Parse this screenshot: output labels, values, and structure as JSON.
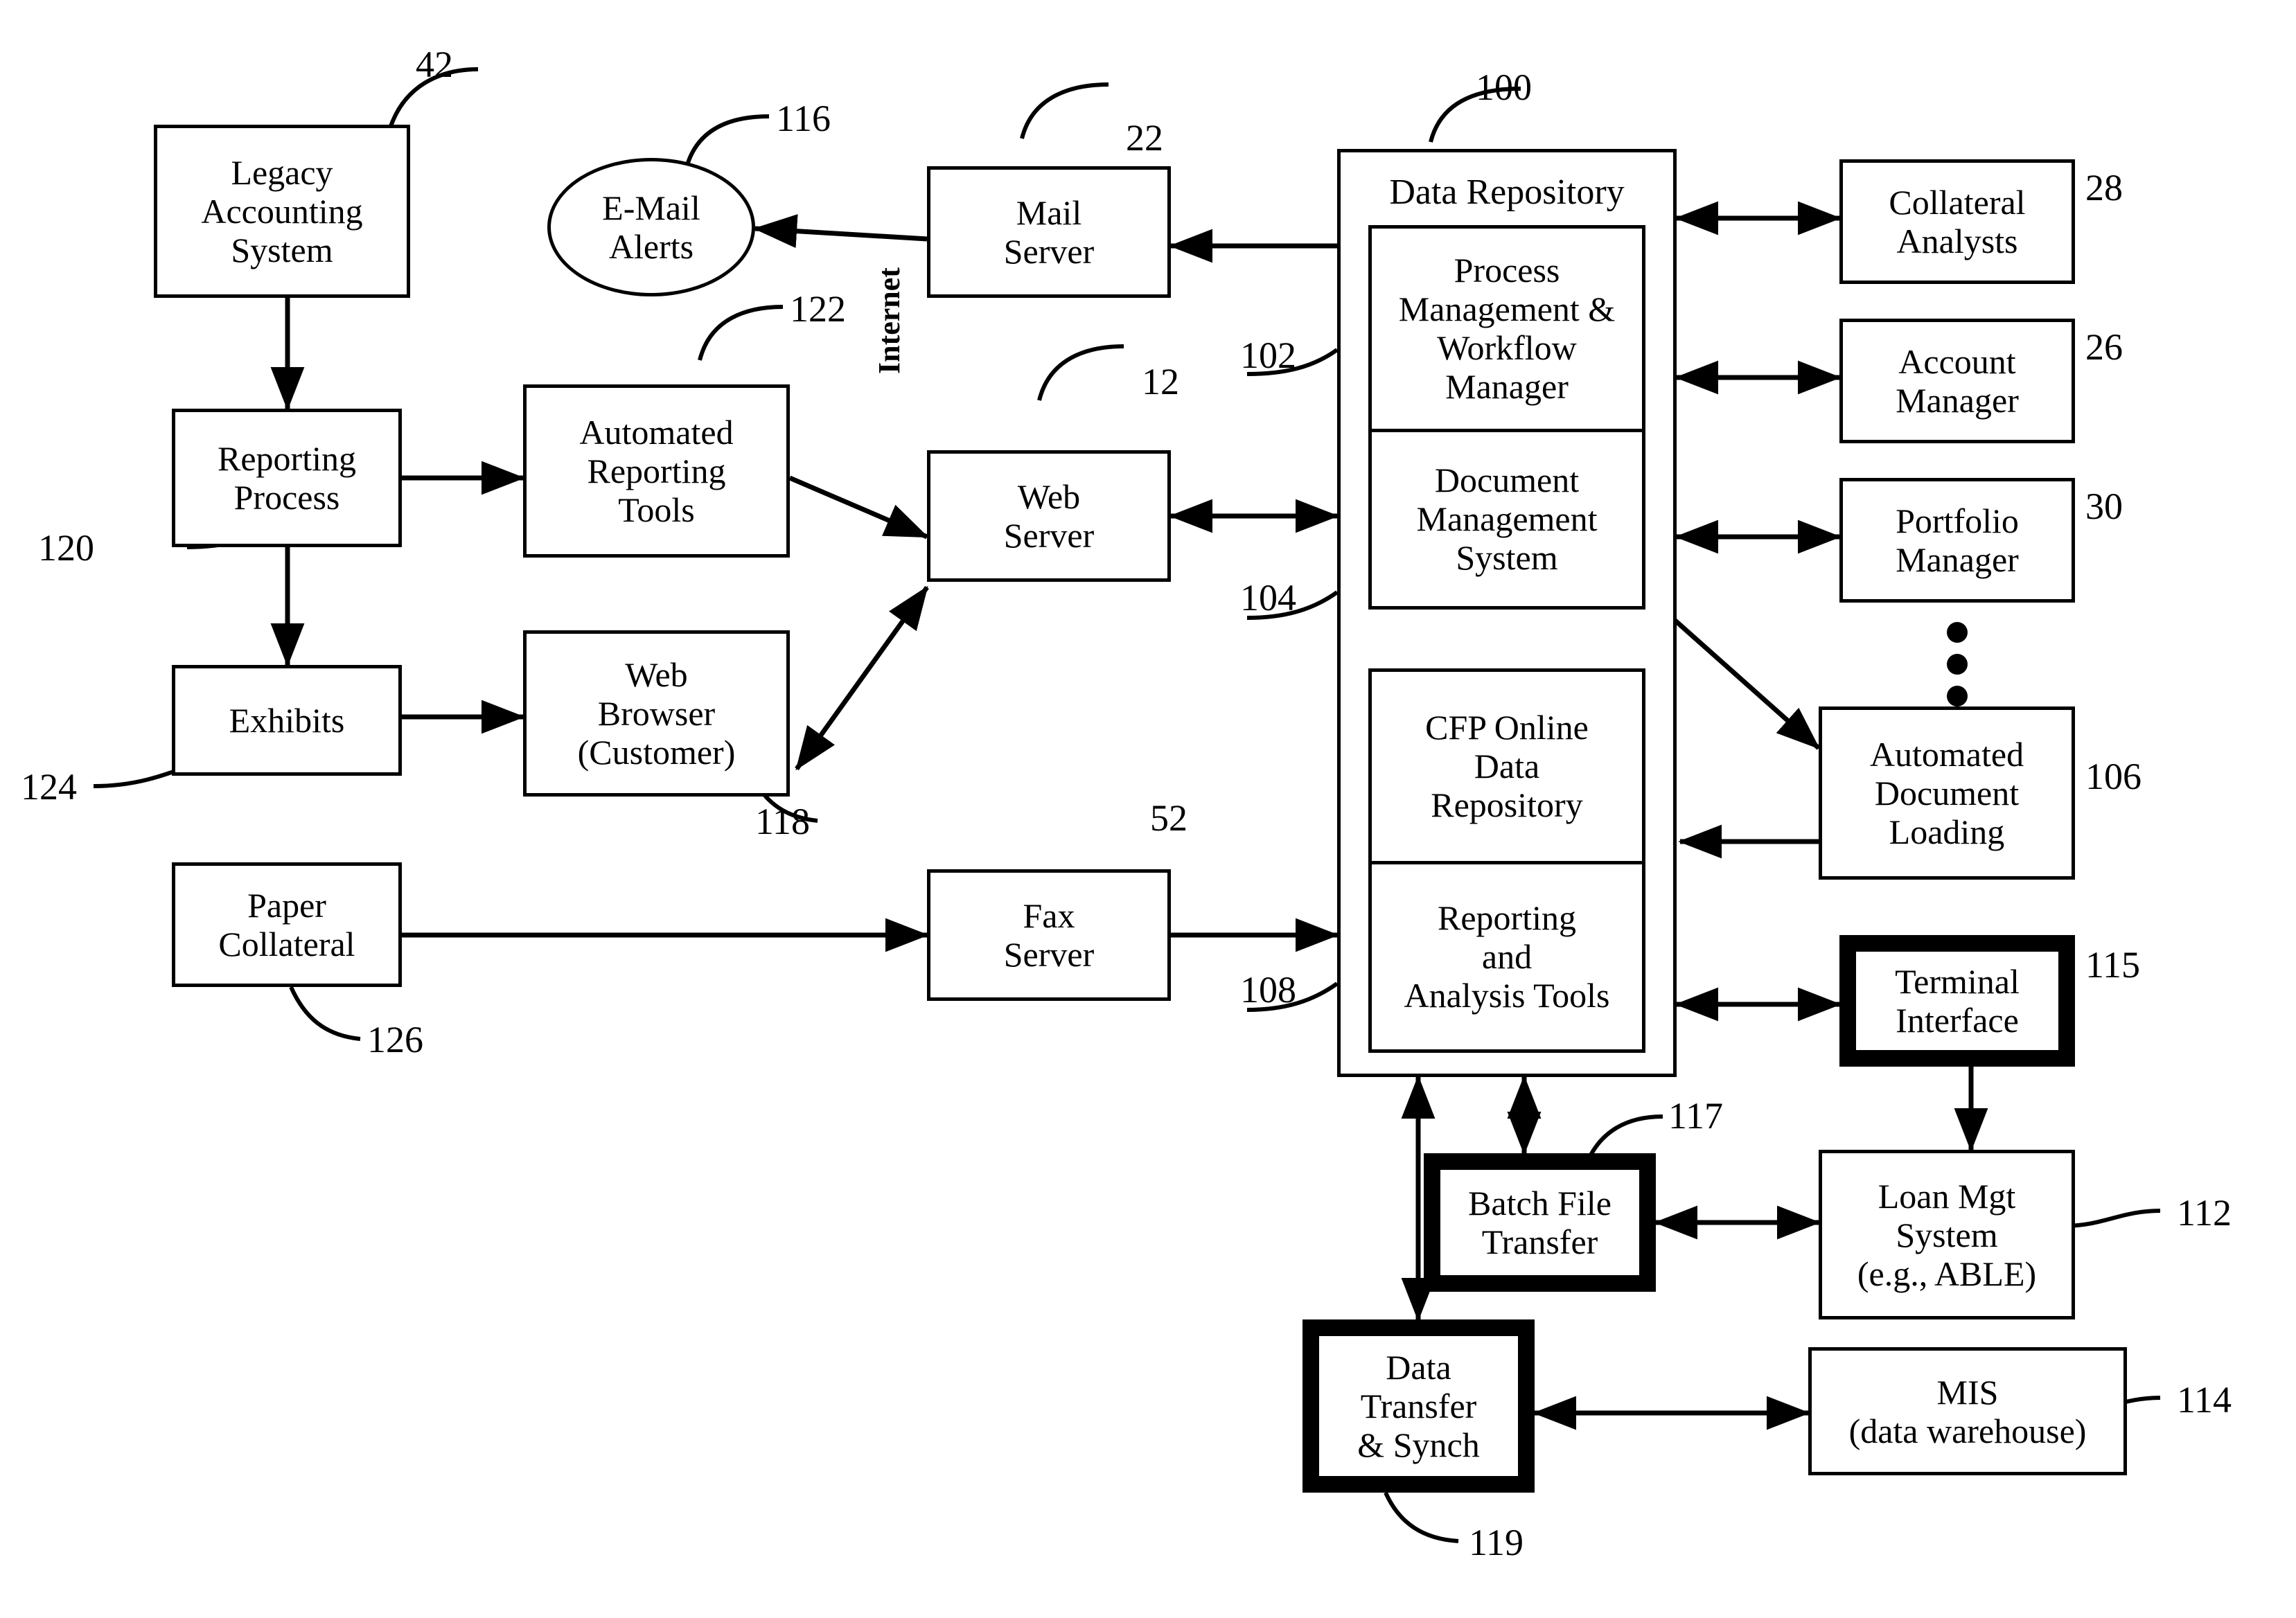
{
  "figure": {
    "type": "patent-system-block-diagram",
    "background": "#ffffff",
    "ink": "#000000"
  },
  "nodes": {
    "legacy_accounting_system": {
      "label": "Legacy\nAccounting\nSystem",
      "ref": "42"
    },
    "email_alerts": {
      "label": "E-Mail\nAlerts",
      "ref": "116",
      "shape": "ellipse"
    },
    "mail_server": {
      "label": "Mail\nServer",
      "ref": "22"
    },
    "reporting_process": {
      "label": "Reporting\nProcess",
      "ref": "120"
    },
    "automated_reporting_tools": {
      "label": "Automated\nReporting\nTools",
      "ref": "122"
    },
    "web_server": {
      "label": "Web\nServer",
      "ref": "12"
    },
    "exhibits": {
      "label": "Exhibits",
      "ref": "124"
    },
    "web_browser_customer": {
      "label": "Web\nBrowser\n(Customer)",
      "ref": "118"
    },
    "paper_collateral": {
      "label": "Paper\nCollateral",
      "ref": "126"
    },
    "fax_server": {
      "label": "Fax\nServer",
      "ref": "52"
    },
    "data_repository": {
      "label": "Data Repository",
      "ref": "100"
    },
    "process_management_workflow_manager": {
      "label": "Process\nManagement &\nWorkflow\nManager",
      "ref": "102"
    },
    "document_management_system": {
      "label": "Document\nManagement\nSystem",
      "ref": "104"
    },
    "cfp_online_data_repository": {
      "label": "CFP Online\nData\nRepository",
      "ref": ""
    },
    "reporting_and_analysis_tools": {
      "label": "Reporting\nand\nAnalysis Tools",
      "ref": "108"
    },
    "collateral_analysts": {
      "label": "Collateral\nAnalysts",
      "ref": "28"
    },
    "account_manager": {
      "label": "Account\nManager",
      "ref": "26"
    },
    "portfolio_manager": {
      "label": "Portfolio\nManager",
      "ref": "30"
    },
    "automated_document_loading": {
      "label": "Automated\nDocument\nLoading",
      "ref": "106"
    },
    "terminal_interface": {
      "label": "Terminal\nInterface",
      "ref": "115",
      "style": "thick-black-border"
    },
    "batch_file_transfer": {
      "label": "Batch File\nTransfer",
      "ref": "117",
      "style": "thick-black-border"
    },
    "data_transfer_synch": {
      "label": "Data\nTransfer\n& Synch",
      "ref": "119",
      "style": "thick-black-border"
    },
    "loan_mgt_system": {
      "label": "Loan Mgt\nSystem\n(e.g., ABLE)",
      "ref": "112"
    },
    "mis_data_warehouse": {
      "label": "MIS\n(data warehouse)",
      "ref": "114"
    }
  },
  "annotations": {
    "internet_label": "Internet",
    "ellipsis_dots": 3
  },
  "reference_numerals": [
    "42",
    "116",
    "22",
    "100",
    "28",
    "26",
    "122",
    "12",
    "102",
    "30",
    "120",
    "104",
    "124",
    "118",
    "106",
    "126",
    "52",
    "108",
    "115",
    "117",
    "112",
    "119",
    "114"
  ]
}
